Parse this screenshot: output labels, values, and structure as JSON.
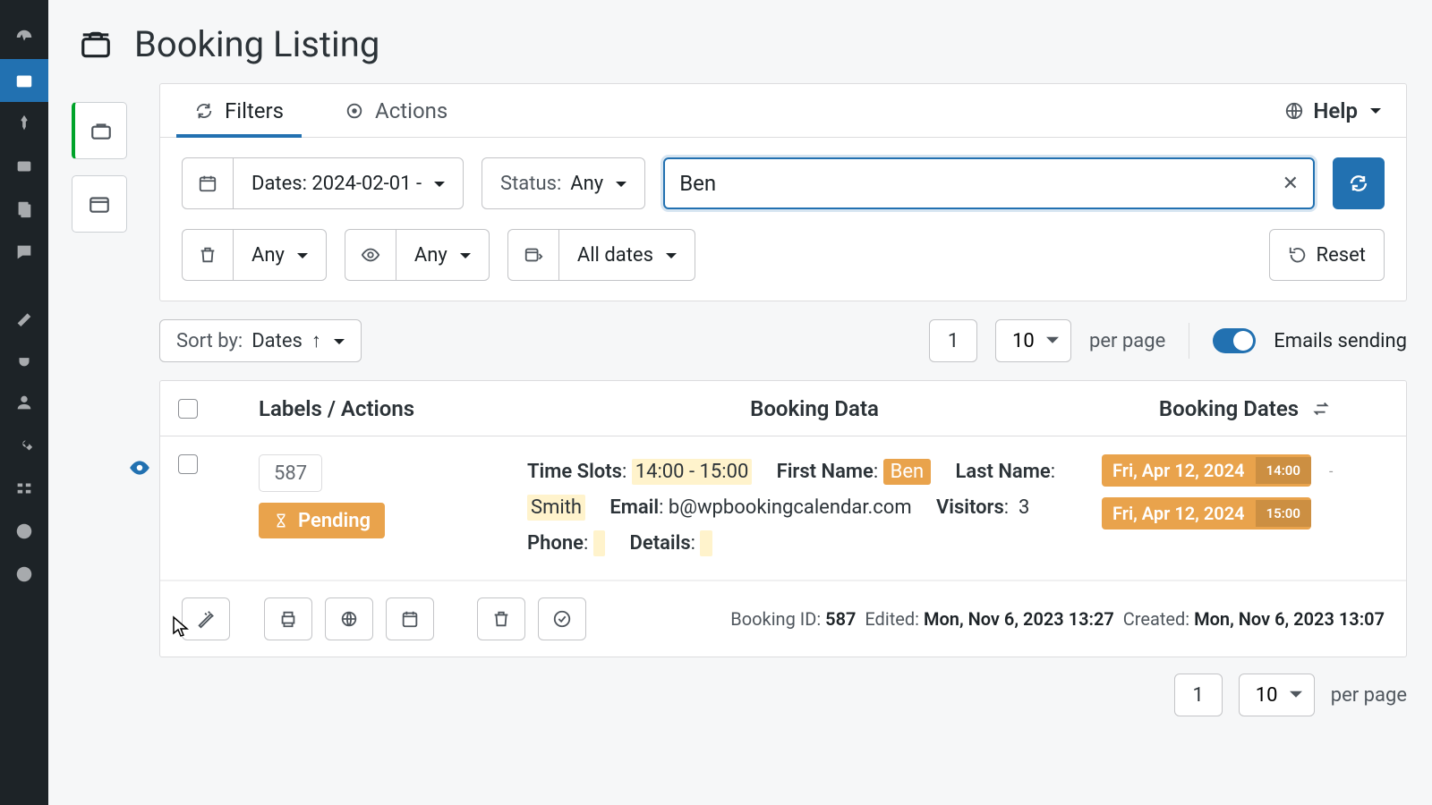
{
  "title": "Booking Listing",
  "tabs": {
    "filters": "Filters",
    "actions": "Actions",
    "help": "Help"
  },
  "filters": {
    "dates_label": "Dates: 2024-02-01 -",
    "status_label": "Status:",
    "status_value": "Any",
    "search_value": "Ben",
    "trash_any": "Any",
    "visibility_any": "Any",
    "date_filter": "All dates",
    "reset": "Reset"
  },
  "sort": {
    "label": "Sort by:",
    "value": "Dates"
  },
  "paging": {
    "page": "1",
    "perpage": "10",
    "perpage_label": "per page"
  },
  "emails_label": "Emails sending",
  "columns": {
    "labels": "Labels / Actions",
    "data": "Booking Data",
    "dates": "Booking Dates"
  },
  "row": {
    "id": "587",
    "status": "Pending",
    "fields": {
      "time_slots_k": "Time Slots",
      "time_slots_v": "14:00 - 15:00",
      "first_name_k": "First Name",
      "first_name_v": "Ben",
      "last_name_k": "Last Name",
      "last_name_v": "Smith",
      "email_k": "Email",
      "email_v": "b@wpbookingcalendar.com",
      "visitors_k": "Visitors",
      "visitors_v": "3",
      "phone_k": "Phone",
      "details_k": "Details"
    },
    "dates": [
      {
        "d": "Fri, Apr 12, 2024",
        "t": "14:00"
      },
      {
        "d": "Fri, Apr 12, 2024",
        "t": "15:00"
      }
    ],
    "meta": {
      "id_label": "Booking ID:",
      "id_val": "587",
      "edited_label": "Edited:",
      "edited_val": "Mon, Nov 6, 2023 13:27",
      "created_label": "Created:",
      "created_val": "Mon, Nov 6, 2023 13:07"
    }
  }
}
